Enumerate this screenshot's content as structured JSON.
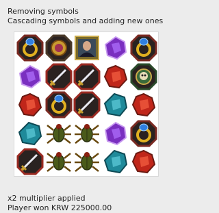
{
  "log": {
    "top": [
      "Removing symbols",
      "Cascading symbols and adding new ones"
    ],
    "bottom": [
      "x2 multiplier applied",
      "Player won KRW 225000.00"
    ]
  },
  "board": {
    "rows": [
      [
        "ring",
        "medallion",
        "portrait",
        "purple-gem",
        "ring"
      ],
      [
        "purple-gem",
        "dagger",
        "dagger",
        "red-gem",
        "skull-octagon"
      ],
      [
        "red-gem",
        "ring",
        "dagger",
        "teal-gem",
        "red-gem"
      ],
      [
        "teal-gem",
        "beetle",
        "beetle",
        "purple-gem",
        "ring"
      ],
      [
        "dagger",
        "beetle",
        "beetle",
        "teal-gem",
        "red-gem"
      ]
    ]
  }
}
